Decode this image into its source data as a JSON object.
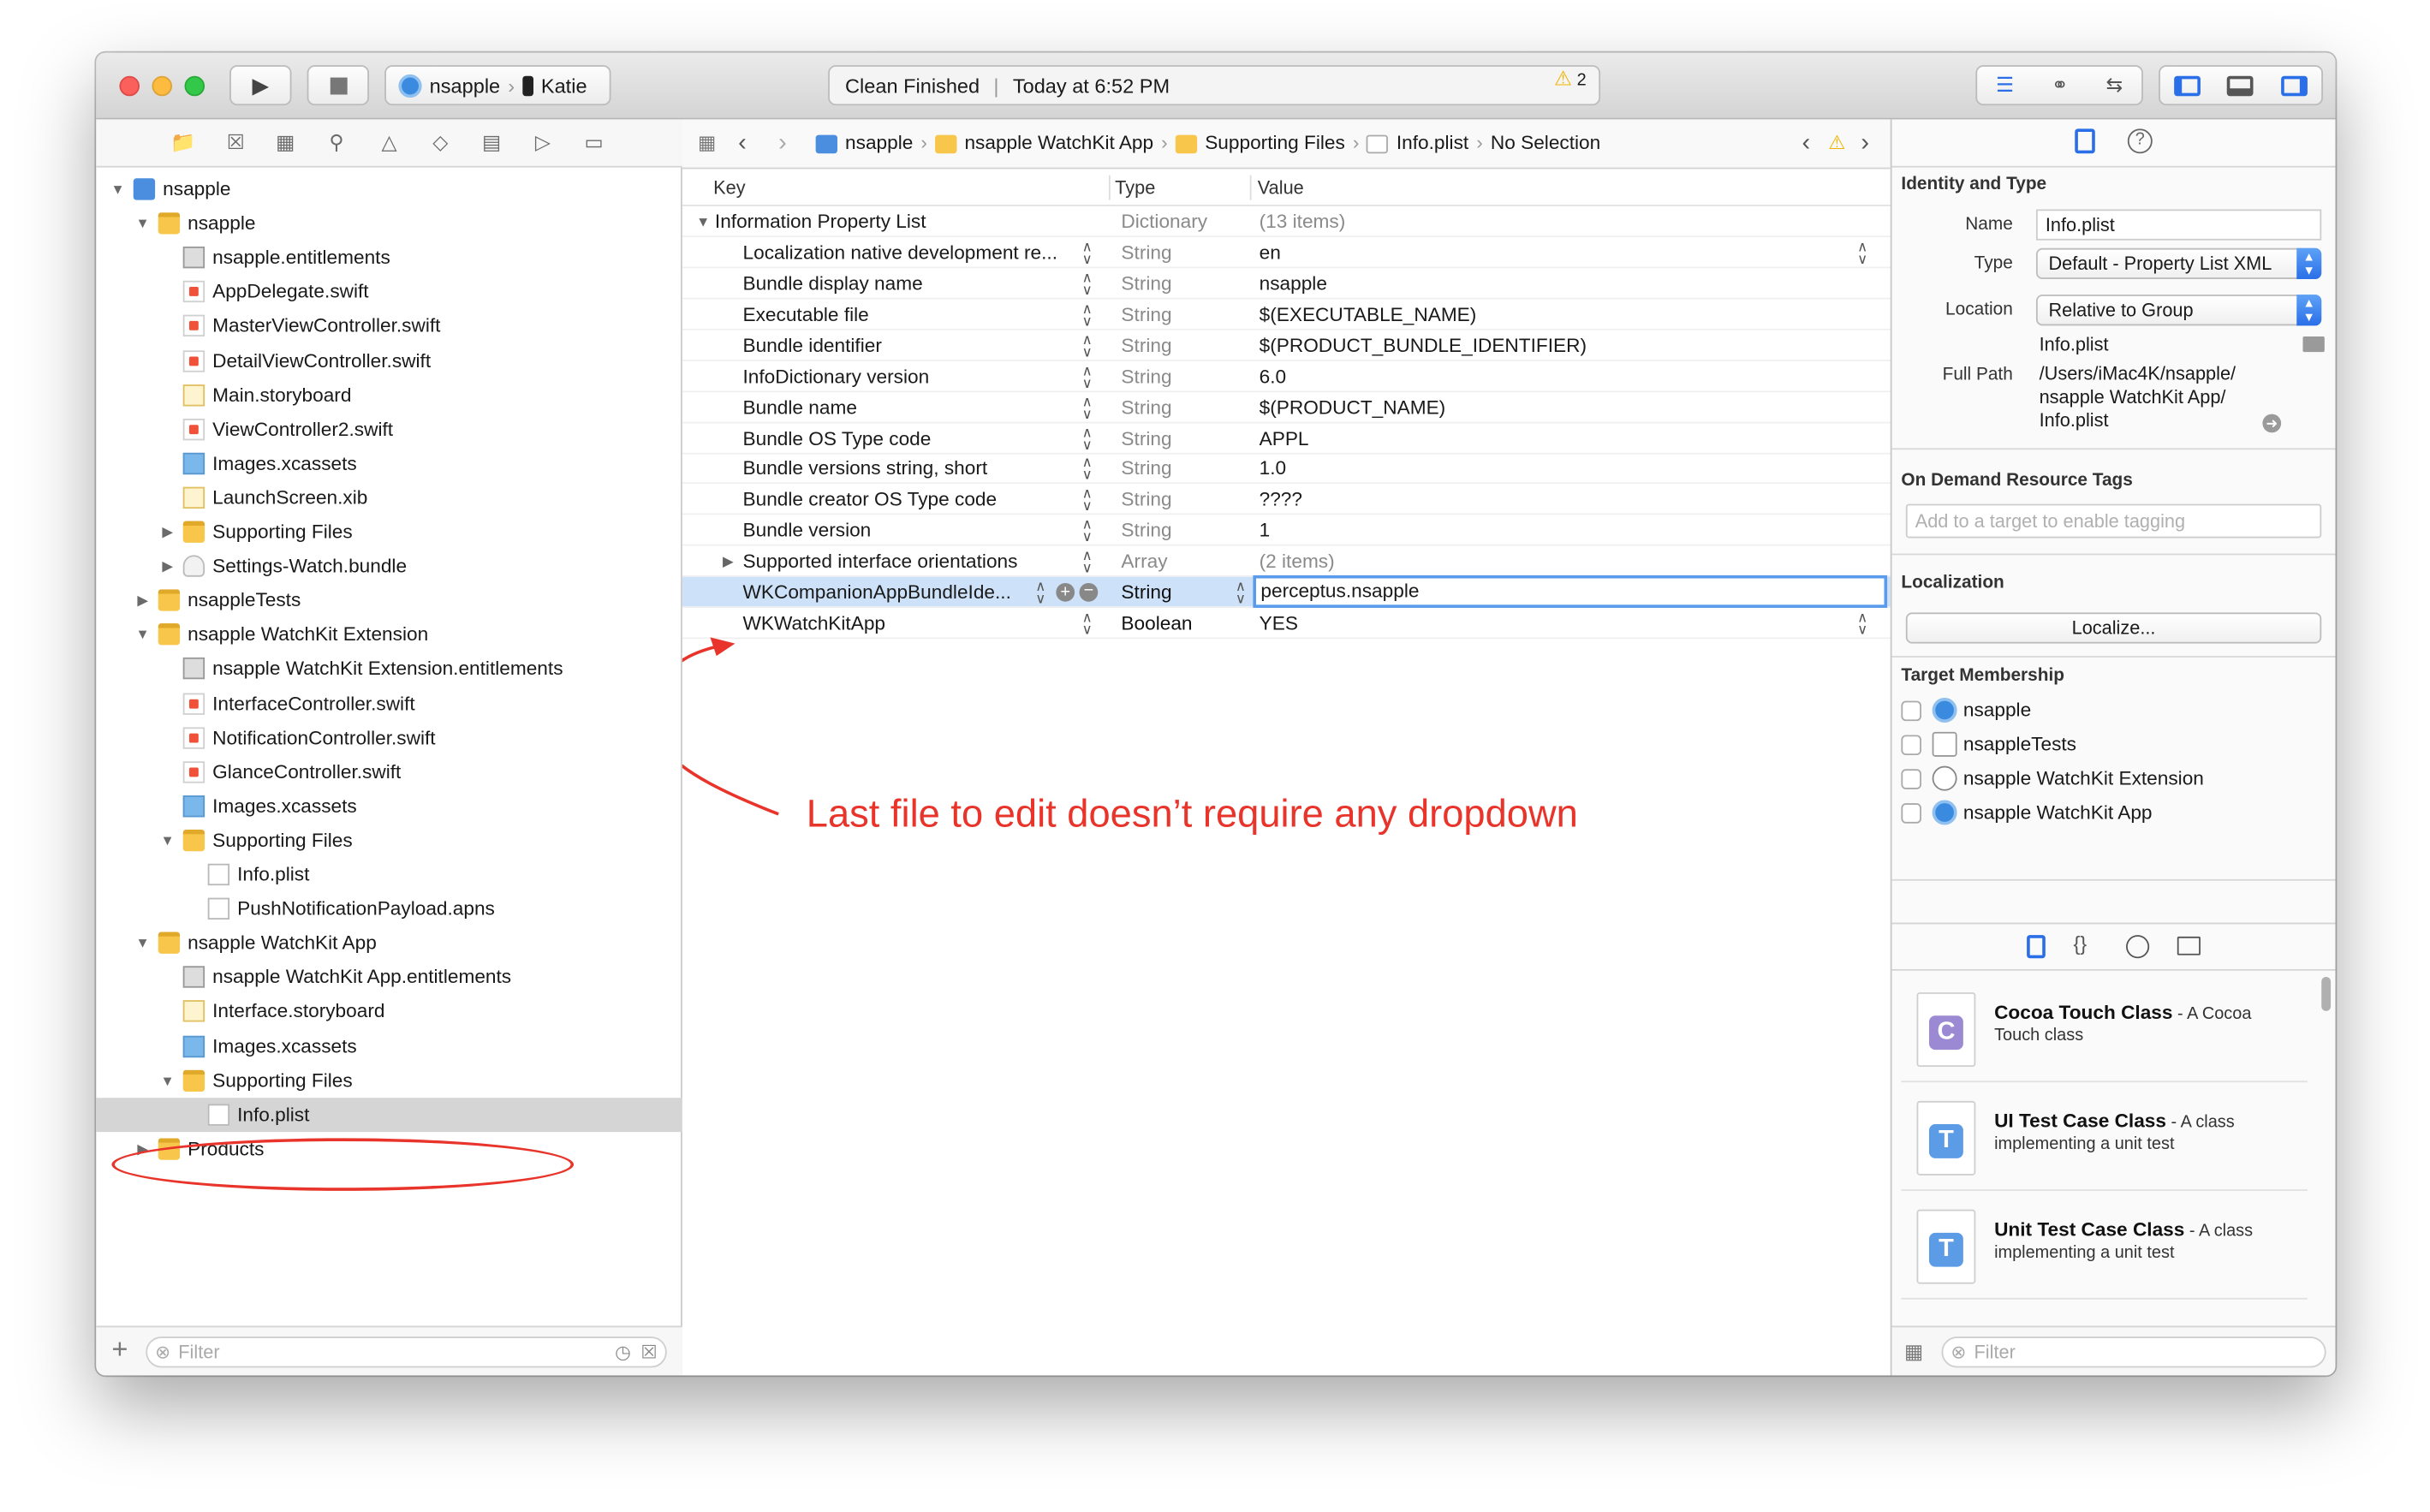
{
  "toolbar": {
    "scheme_project": "nsapple",
    "scheme_device": "Katie",
    "status_text": "Clean Finished",
    "status_time": "Today at 6:52 PM",
    "warning_count": "2"
  },
  "navigator": {
    "tree": [
      {
        "label": "nsapple",
        "kind": "proj",
        "indent": 0,
        "expanded": true
      },
      {
        "label": "nsapple",
        "kind": "folder",
        "indent": 1,
        "expanded": true
      },
      {
        "label": "nsapple.entitlements",
        "kind": "ent",
        "indent": 2
      },
      {
        "label": "AppDelegate.swift",
        "kind": "swift",
        "indent": 2
      },
      {
        "label": "MasterViewController.swift",
        "kind": "swift",
        "indent": 2
      },
      {
        "label": "DetailViewController.swift",
        "kind": "swift",
        "indent": 2
      },
      {
        "label": "Main.storyboard",
        "kind": "sb",
        "indent": 2
      },
      {
        "label": "ViewController2.swift",
        "kind": "swift",
        "indent": 2
      },
      {
        "label": "Images.xcassets",
        "kind": "asset",
        "indent": 2
      },
      {
        "label": "LaunchScreen.xib",
        "kind": "sb",
        "indent": 2
      },
      {
        "label": "Supporting Files",
        "kind": "folder",
        "indent": 2,
        "expanded": false
      },
      {
        "label": "Settings-Watch.bundle",
        "kind": "bundle",
        "indent": 2,
        "expanded": false
      },
      {
        "label": "nsappleTests",
        "kind": "folder",
        "indent": 1,
        "expanded": false
      },
      {
        "label": "nsapple WatchKit Extension",
        "kind": "folder",
        "indent": 1,
        "expanded": true
      },
      {
        "label": "nsapple WatchKit Extension.entitlements",
        "kind": "ent",
        "indent": 2
      },
      {
        "label": "InterfaceController.swift",
        "kind": "swift",
        "indent": 2
      },
      {
        "label": "NotificationController.swift",
        "kind": "swift",
        "indent": 2
      },
      {
        "label": "GlanceController.swift",
        "kind": "swift",
        "indent": 2
      },
      {
        "label": "Images.xcassets",
        "kind": "asset",
        "indent": 2
      },
      {
        "label": "Supporting Files",
        "kind": "folder",
        "indent": 2,
        "expanded": true
      },
      {
        "label": "Info.plist",
        "kind": "plainf",
        "indent": 3
      },
      {
        "label": "PushNotificationPayload.apns",
        "kind": "plainf",
        "indent": 3
      },
      {
        "label": "nsapple WatchKit App",
        "kind": "folder",
        "indent": 1,
        "expanded": true
      },
      {
        "label": "nsapple WatchKit App.entitlements",
        "kind": "ent",
        "indent": 2
      },
      {
        "label": "Interface.storyboard",
        "kind": "sb",
        "indent": 2
      },
      {
        "label": "Images.xcassets",
        "kind": "asset",
        "indent": 2
      },
      {
        "label": "Supporting Files",
        "kind": "folder",
        "indent": 2,
        "expanded": true
      },
      {
        "label": "Info.plist",
        "kind": "plainf",
        "indent": 3,
        "selected": true
      },
      {
        "label": "Products",
        "kind": "folder",
        "indent": 1,
        "expanded": false
      }
    ],
    "filter_placeholder": "Filter"
  },
  "editor": {
    "breadcrumb": [
      "nsapple",
      "nsapple WatchKit App",
      "Supporting Files",
      "Info.plist",
      "No Selection"
    ],
    "columns": {
      "key": "Key",
      "type": "Type",
      "value": "Value"
    },
    "root": {
      "key": "Information Property List",
      "type": "Dictionary",
      "value": "(13 items)"
    },
    "rows": [
      {
        "key": "Localization native development re...",
        "type": "String",
        "value": "en",
        "popup": true
      },
      {
        "key": "Bundle display name",
        "type": "String",
        "value": "nsapple"
      },
      {
        "key": "Executable file",
        "type": "String",
        "value": "$(EXECUTABLE_NAME)"
      },
      {
        "key": "Bundle identifier",
        "type": "String",
        "value": "$(PRODUCT_BUNDLE_IDENTIFIER)"
      },
      {
        "key": "InfoDictionary version",
        "type": "String",
        "value": "6.0"
      },
      {
        "key": "Bundle name",
        "type": "String",
        "value": "$(PRODUCT_NAME)"
      },
      {
        "key": "Bundle OS Type code",
        "type": "String",
        "value": "APPL"
      },
      {
        "key": "Bundle versions string, short",
        "type": "String",
        "value": "1.0"
      },
      {
        "key": "Bundle creator OS Type code",
        "type": "String",
        "value": "????"
      },
      {
        "key": "Bundle version",
        "type": "String",
        "value": "1"
      },
      {
        "key": "Supported interface orientations",
        "type": "Array",
        "value": "(2 items)",
        "collapsed": true
      },
      {
        "key": "WKCompanionAppBundleIde...",
        "type": "String",
        "value": "perceptus.nsapple",
        "selected": true
      },
      {
        "key": "WKWatchKitApp",
        "type": "Boolean",
        "value": "YES",
        "popup": true
      }
    ],
    "annotation": "Last file to edit doesn’t require any dropdown"
  },
  "inspector": {
    "identity_header": "Identity and Type",
    "name_label": "Name",
    "name_value": "Info.plist",
    "type_label": "Type",
    "type_value": "Default - Property List XML",
    "location_label": "Location",
    "location_value": "Relative to Group",
    "location_file": "Info.plist",
    "fullpath_label": "Full Path",
    "fullpath_lines": [
      "/Users/iMac4K/nsapple/",
      "nsapple WatchKit App/",
      "Info.plist"
    ],
    "odr_header": "On Demand Resource Tags",
    "odr_placeholder": "Add to a target to enable tagging",
    "localization_header": "Localization",
    "localize_button": "Localize...",
    "membership_header": "Target Membership",
    "targets": [
      "nsapple",
      "nsappleTests",
      "nsapple WatchKit Extension",
      "nsapple WatchKit App"
    ],
    "templates": [
      {
        "title": "Cocoa Touch Class",
        "desc": " - A Cocoa Touch class",
        "letter": "C",
        "color": "#9b8ad3"
      },
      {
        "title": "UI Test Case Class",
        "desc": " - A class implementing a unit test",
        "letter": "T",
        "color": "#5c9ce6"
      },
      {
        "title": "Unit Test Case Class",
        "desc": " - A class implementing a unit test",
        "letter": "T",
        "color": "#5c9ce6"
      }
    ],
    "filter_placeholder": "Filter"
  }
}
